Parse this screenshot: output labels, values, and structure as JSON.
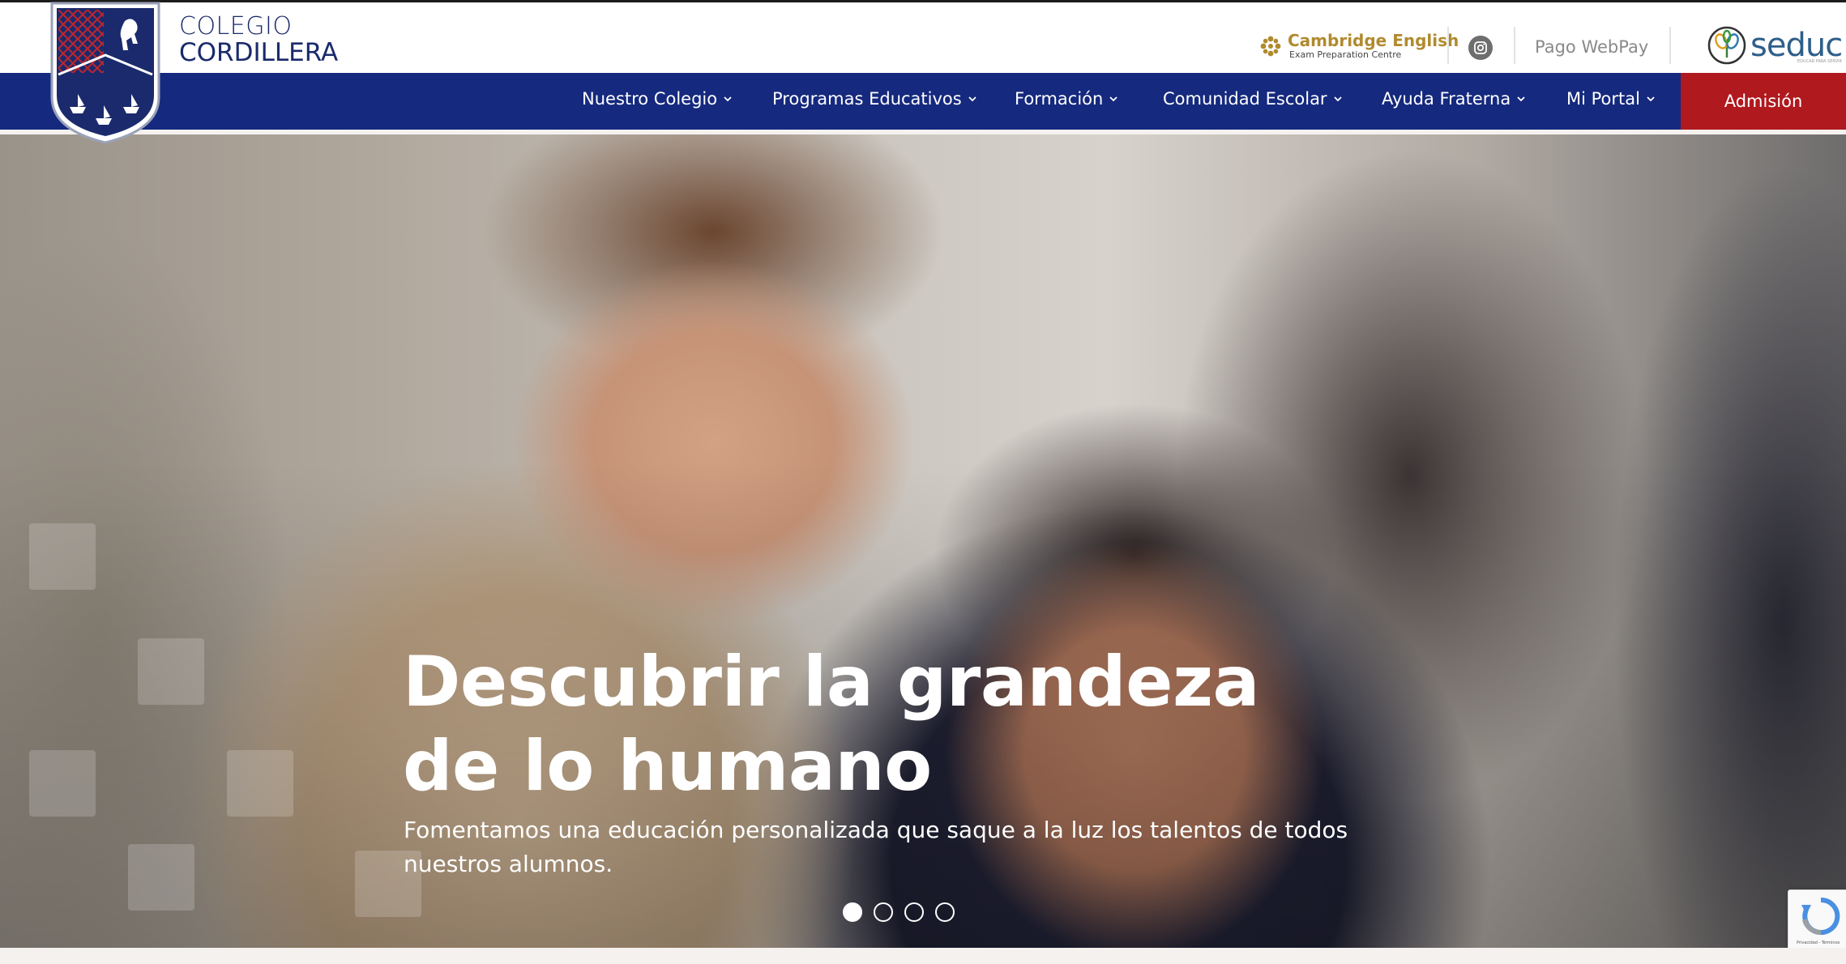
{
  "brand": {
    "line1": "COLEGIO",
    "line2": "CORDILLERA"
  },
  "partners": {
    "cambridge_title": "Cambridge English",
    "cambridge_subtitle": "Exam Preparation Centre",
    "instagram_icon": "instagram-icon",
    "pago": "Pago WebPay",
    "seduc": "seduc",
    "seduc_tagline": "EDUCAR PARA SERVIR"
  },
  "nav": {
    "items": [
      {
        "label": "Nuestro Colegio"
      },
      {
        "label": "Programas Educativos"
      },
      {
        "label": "Formación"
      },
      {
        "label": "Comunidad Escolar"
      },
      {
        "label": "Ayuda Fraterna"
      },
      {
        "label": "Mi Portal"
      }
    ],
    "admission": "Admisión"
  },
  "hero": {
    "title": "Descubrir la grandeza de lo humano",
    "subtitle": "Fomentamos una educación personalizada que saque a la luz los talentos de todos nuestros alumnos.",
    "slides": 4,
    "active_slide": 1
  },
  "recaptcha": {
    "text": "Privacidad - Términos"
  },
  "colors": {
    "navy": "#15297e",
    "admission_red": "#b0191e",
    "cambridge_gold": "#b08a2e",
    "seduc_blue": "#2e5e8a"
  }
}
